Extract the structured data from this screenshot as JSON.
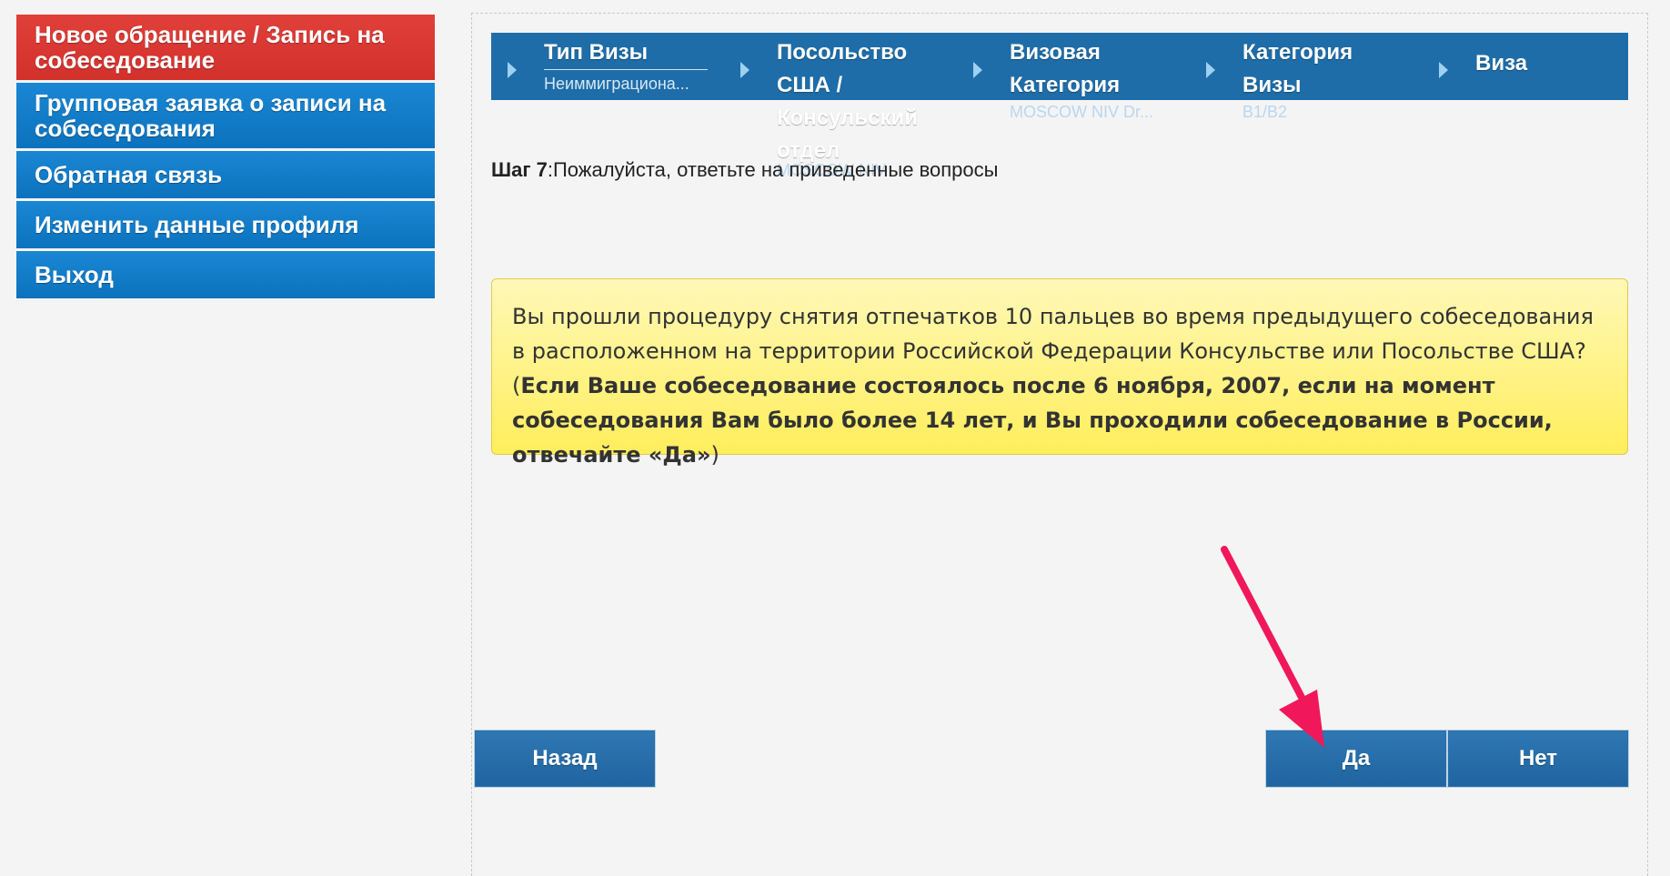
{
  "nav": {
    "items": [
      {
        "label": "Новое обращение / Запись на собеседование",
        "active": true
      },
      {
        "label": "Групповая заявка о записи на собеседования",
        "active": false
      },
      {
        "label": "Обратная связь",
        "active": false
      },
      {
        "label": "Изменить данные профиля",
        "active": false
      },
      {
        "label": "Выход",
        "active": false
      }
    ]
  },
  "steps": [
    {
      "title": "Тип Визы",
      "value": "Неиммиграциона..."
    },
    {
      "title": "Посольство США / Консульский отдел",
      "value": "MOSCOW NIV"
    },
    {
      "title": "Визовая Категория",
      "value": "MOSCOW NIV Dr..."
    },
    {
      "title": "Категория Визы",
      "value": "B1/B2"
    },
    {
      "title": "Виза",
      "value": ""
    }
  ],
  "instruction": {
    "step_label": "Шаг 7",
    "text": ":Пожалуйста, ответьте на приведенные вопросы"
  },
  "question": {
    "text": "Вы прошли процедуру снятия отпечатков 10 пальцев во время предыдущего собеседования в расположенном на территории Российской Федерации Консульстве или Посольстве США? (",
    "bold": "Если Ваше собеседование состоялось после 6 ноября, 2007,  если на момент собеседования Вам было более 14 лет, и Вы проходили собеседование в России, отвечайте «Да»",
    "end": ")"
  },
  "buttons": {
    "back": "Назад",
    "yes": "Да",
    "no": "Нет"
  },
  "colors": {
    "nav_blue": "#0c72bd",
    "nav_red": "#d3302c",
    "step_bar": "#1e6da8",
    "button": "#1f64a0",
    "annotation_arrow": "#f0185a"
  }
}
